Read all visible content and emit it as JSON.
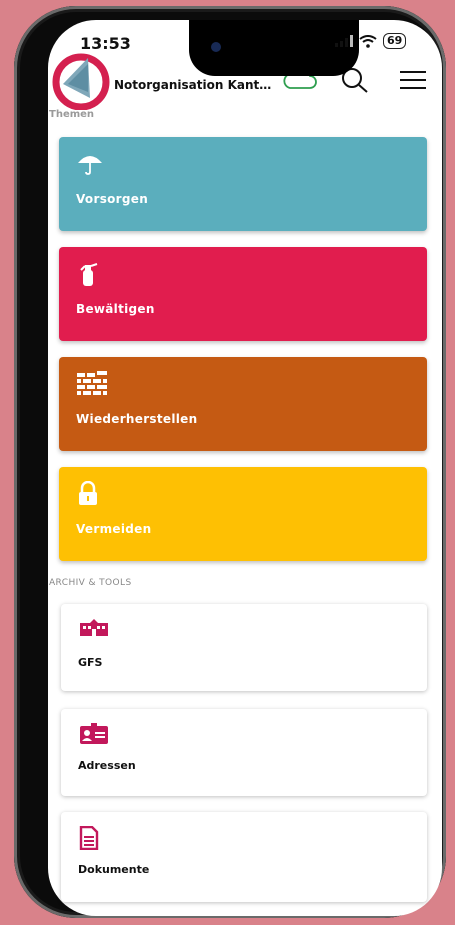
{
  "status_bar": {
    "time": "13:53",
    "battery": "69"
  },
  "header": {
    "title": "Notorganisation Kanton…"
  },
  "sections": {
    "themen": "Themen",
    "archiv": "ARCHIV & TOOLS"
  },
  "tiles": [
    {
      "label": "Vorsorgen",
      "icon": "umbrella-icon",
      "color": "#5baebd"
    },
    {
      "label": "Bewältigen",
      "icon": "fire-extinguisher-icon",
      "color": "#e11d4e"
    },
    {
      "label": "Wiederherstellen",
      "icon": "brick-wall-icon",
      "color": "#c55a13"
    },
    {
      "label": "Vermeiden",
      "icon": "lock-icon",
      "color": "#fec003"
    }
  ],
  "tools": [
    {
      "label": "GFS",
      "icon": "building-icon"
    },
    {
      "label": "Adressen",
      "icon": "contact-card-icon"
    },
    {
      "label": "Dokumente",
      "icon": "document-icon"
    }
  ],
  "colors": {
    "accent": "#c2185b",
    "cloud": "#2e9e4f",
    "background": "#d9828a"
  }
}
